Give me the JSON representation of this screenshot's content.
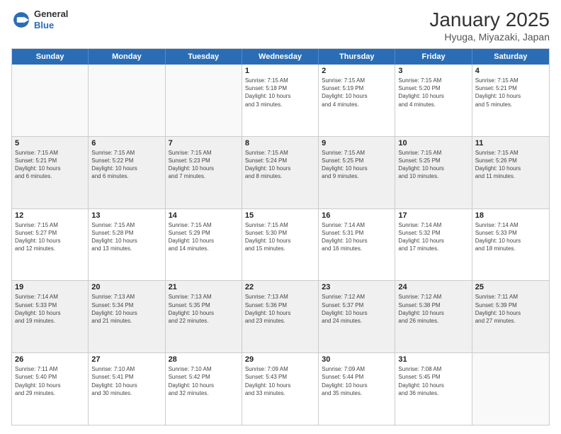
{
  "header": {
    "logo_general": "General",
    "logo_blue": "Blue",
    "title": "January 2025",
    "subtitle": "Hyuga, Miyazaki, Japan"
  },
  "weekdays": [
    "Sunday",
    "Monday",
    "Tuesday",
    "Wednesday",
    "Thursday",
    "Friday",
    "Saturday"
  ],
  "rows": [
    [
      {
        "day": "",
        "info": "",
        "empty": true
      },
      {
        "day": "",
        "info": "",
        "empty": true
      },
      {
        "day": "",
        "info": "",
        "empty": true
      },
      {
        "day": "1",
        "info": "Sunrise: 7:15 AM\nSunset: 5:18 PM\nDaylight: 10 hours\nand 3 minutes."
      },
      {
        "day": "2",
        "info": "Sunrise: 7:15 AM\nSunset: 5:19 PM\nDaylight: 10 hours\nand 4 minutes."
      },
      {
        "day": "3",
        "info": "Sunrise: 7:15 AM\nSunset: 5:20 PM\nDaylight: 10 hours\nand 4 minutes."
      },
      {
        "day": "4",
        "info": "Sunrise: 7:15 AM\nSunset: 5:21 PM\nDaylight: 10 hours\nand 5 minutes."
      }
    ],
    [
      {
        "day": "5",
        "info": "Sunrise: 7:15 AM\nSunset: 5:21 PM\nDaylight: 10 hours\nand 6 minutes."
      },
      {
        "day": "6",
        "info": "Sunrise: 7:15 AM\nSunset: 5:22 PM\nDaylight: 10 hours\nand 6 minutes."
      },
      {
        "day": "7",
        "info": "Sunrise: 7:15 AM\nSunset: 5:23 PM\nDaylight: 10 hours\nand 7 minutes."
      },
      {
        "day": "8",
        "info": "Sunrise: 7:15 AM\nSunset: 5:24 PM\nDaylight: 10 hours\nand 8 minutes."
      },
      {
        "day": "9",
        "info": "Sunrise: 7:15 AM\nSunset: 5:25 PM\nDaylight: 10 hours\nand 9 minutes."
      },
      {
        "day": "10",
        "info": "Sunrise: 7:15 AM\nSunset: 5:25 PM\nDaylight: 10 hours\nand 10 minutes."
      },
      {
        "day": "11",
        "info": "Sunrise: 7:15 AM\nSunset: 5:26 PM\nDaylight: 10 hours\nand 11 minutes."
      }
    ],
    [
      {
        "day": "12",
        "info": "Sunrise: 7:15 AM\nSunset: 5:27 PM\nDaylight: 10 hours\nand 12 minutes."
      },
      {
        "day": "13",
        "info": "Sunrise: 7:15 AM\nSunset: 5:28 PM\nDaylight: 10 hours\nand 13 minutes."
      },
      {
        "day": "14",
        "info": "Sunrise: 7:15 AM\nSunset: 5:29 PM\nDaylight: 10 hours\nand 14 minutes."
      },
      {
        "day": "15",
        "info": "Sunrise: 7:15 AM\nSunset: 5:30 PM\nDaylight: 10 hours\nand 15 minutes."
      },
      {
        "day": "16",
        "info": "Sunrise: 7:14 AM\nSunset: 5:31 PM\nDaylight: 10 hours\nand 16 minutes."
      },
      {
        "day": "17",
        "info": "Sunrise: 7:14 AM\nSunset: 5:32 PM\nDaylight: 10 hours\nand 17 minutes."
      },
      {
        "day": "18",
        "info": "Sunrise: 7:14 AM\nSunset: 5:33 PM\nDaylight: 10 hours\nand 18 minutes."
      }
    ],
    [
      {
        "day": "19",
        "info": "Sunrise: 7:14 AM\nSunset: 5:33 PM\nDaylight: 10 hours\nand 19 minutes."
      },
      {
        "day": "20",
        "info": "Sunrise: 7:13 AM\nSunset: 5:34 PM\nDaylight: 10 hours\nand 21 minutes."
      },
      {
        "day": "21",
        "info": "Sunrise: 7:13 AM\nSunset: 5:35 PM\nDaylight: 10 hours\nand 22 minutes."
      },
      {
        "day": "22",
        "info": "Sunrise: 7:13 AM\nSunset: 5:36 PM\nDaylight: 10 hours\nand 23 minutes."
      },
      {
        "day": "23",
        "info": "Sunrise: 7:12 AM\nSunset: 5:37 PM\nDaylight: 10 hours\nand 24 minutes."
      },
      {
        "day": "24",
        "info": "Sunrise: 7:12 AM\nSunset: 5:38 PM\nDaylight: 10 hours\nand 26 minutes."
      },
      {
        "day": "25",
        "info": "Sunrise: 7:11 AM\nSunset: 5:39 PM\nDaylight: 10 hours\nand 27 minutes."
      }
    ],
    [
      {
        "day": "26",
        "info": "Sunrise: 7:11 AM\nSunset: 5:40 PM\nDaylight: 10 hours\nand 29 minutes."
      },
      {
        "day": "27",
        "info": "Sunrise: 7:10 AM\nSunset: 5:41 PM\nDaylight: 10 hours\nand 30 minutes."
      },
      {
        "day": "28",
        "info": "Sunrise: 7:10 AM\nSunset: 5:42 PM\nDaylight: 10 hours\nand 32 minutes."
      },
      {
        "day": "29",
        "info": "Sunrise: 7:09 AM\nSunset: 5:43 PM\nDaylight: 10 hours\nand 33 minutes."
      },
      {
        "day": "30",
        "info": "Sunrise: 7:09 AM\nSunset: 5:44 PM\nDaylight: 10 hours\nand 35 minutes."
      },
      {
        "day": "31",
        "info": "Sunrise: 7:08 AM\nSunset: 5:45 PM\nDaylight: 10 hours\nand 36 minutes."
      },
      {
        "day": "",
        "info": "",
        "empty": true
      }
    ]
  ]
}
